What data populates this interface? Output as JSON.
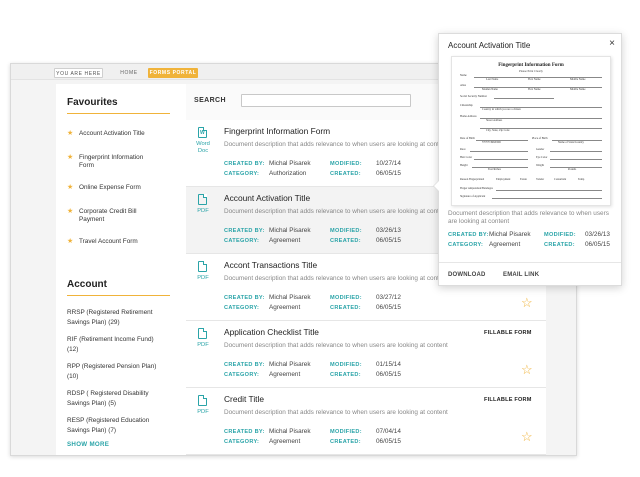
{
  "breadcrumb": {
    "you_are_here": "YOU ARE HERE",
    "home": "HOME",
    "current": "FORMS PORTAL"
  },
  "sidebar": {
    "favourites_heading": "Favourites",
    "favourites": [
      {
        "line1": "Account Activation Title",
        "line2": ""
      },
      {
        "line1": "Fingerprint Information",
        "line2": "Form"
      },
      {
        "line1": "Online Expense Form",
        "line2": ""
      },
      {
        "line1": "Corporate Credit Bill",
        "line2": "Payment"
      },
      {
        "line1": "Travel Account Form",
        "line2": ""
      }
    ],
    "account_heading": "Account",
    "accounts": [
      {
        "line1": "RRSP (Registered Retirement",
        "line2": "Savings Plan) (29)"
      },
      {
        "line1": "RIF (Retirement Income Fund)",
        "line2": "(12)"
      },
      {
        "line1": "RPP (Registered Pension Plan)",
        "line2": "(10)"
      },
      {
        "line1": "RDSP ( Registered Disability",
        "line2": "Savings Plan) (5)"
      },
      {
        "line1": "RESP (Registered Education",
        "line2": "Savings Plan) (7)"
      }
    ],
    "show_more": "SHOW MORE"
  },
  "search": {
    "label": "SEARCH",
    "value": "",
    "placeholder": ""
  },
  "labels": {
    "created_by": "CREATED BY:",
    "category": "CATEGORY:",
    "modified": "MODIFIED:",
    "created": "CREATED:"
  },
  "documents": [
    {
      "title": "Fingerprint Information Form",
      "type_line1": "Word",
      "type_line2": "Doc",
      "icon_glyph": "W",
      "description": "Document description that adds relevance to when users are looking at content",
      "created_by": "Michal Pisarek",
      "category": "Authorization",
      "modified": "10/27/14",
      "created": "06/05/15",
      "tag": ""
    },
    {
      "title": "Account Activation Title",
      "type_line1": "PDF",
      "type_line2": "",
      "icon_glyph": "",
      "description": "Document description that adds relevance to when users are looking at content",
      "created_by": "Michal Pisarek",
      "category": "Agreement",
      "modified": "03/26/13",
      "created": "06/05/15",
      "tag": ""
    },
    {
      "title": "Accont Transactions Title",
      "type_line1": "PDF",
      "type_line2": "",
      "icon_glyph": "",
      "description": "Document description that adds relevance to when users are looking at content",
      "created_by": "Michal Pisarek",
      "category": "Agreement",
      "modified": "03/27/12",
      "created": "06/05/15",
      "tag": ""
    },
    {
      "title": "Application Checklist Title",
      "type_line1": "PDF",
      "type_line2": "",
      "icon_glyph": "",
      "description": "Document description that adds relevance to when users are looking at content",
      "created_by": "Michal Pisarek",
      "category": "Agreement",
      "modified": "01/15/14",
      "created": "06/05/15",
      "tag": "FILLABLE FORM"
    },
    {
      "title": "Credit Title",
      "type_line1": "PDF",
      "type_line2": "",
      "icon_glyph": "",
      "description": "Document description that adds relevance to when users are looking at content",
      "created_by": "Michal Pisarek",
      "category": "Agreement",
      "modified": "07/04/14",
      "created": "06/05/15",
      "tag": "FILLABLE FORM"
    }
  ],
  "popup": {
    "title": "Account Activation Title",
    "close": "×",
    "preview": {
      "form_title": "Fingerprint Information Form",
      "form_subtitle": "Please Print Clearly",
      "name_labels": [
        "Name",
        "Last Name",
        "First Name",
        "Middle Name"
      ],
      "alias_labels": [
        "Alias",
        "Maiden Name",
        "First Name",
        "Middle Name"
      ],
      "ssn_label": "Social Security Number",
      "citizenship_label": "Citizenship",
      "citizenship_sub": "Country in which you are a citizen",
      "home_address_label": "Home Address",
      "street_label": "Street Address",
      "city_labels": [
        "City, State, Zip Code"
      ],
      "dob_label": "Date of Birth",
      "place_of_birth_label": "Place of Birth",
      "dob_format": "YYYY/MM/DD",
      "place_format": "Name of State/Country",
      "race_label": "Race",
      "gender_label": "Gender",
      "hair_label": "Hair Color",
      "eye_label": "Eye Color",
      "height_label": "Height",
      "weight_label": "Weight",
      "height_unit": "Feet/Inches",
      "weight_unit": "Pounds",
      "reason_label": "Reason Fingerprinted",
      "reason_options": [
        "Employment",
        "Estate",
        "Vendor",
        "Consultant",
        "Temp"
      ],
      "finger_label": "Finger Amputation/Bandages",
      "signature_label": "Signature of Applicant"
    },
    "description": "Document description that adds relevance to when users are looking at content",
    "created_by": "Michal Pisarek",
    "category": "Agreement",
    "modified": "03/26/13",
    "created": "06/05/15",
    "download": "DOWNLOAD",
    "email_link": "EMAIL LINK"
  },
  "colors": {
    "accent_teal": "#2aa4a8",
    "accent_gold": "#f0b33a"
  },
  "icons": {
    "favourite": "star-icon",
    "document_word": "word-doc-icon",
    "document_pdf": "pdf-doc-icon",
    "close": "close-icon"
  }
}
